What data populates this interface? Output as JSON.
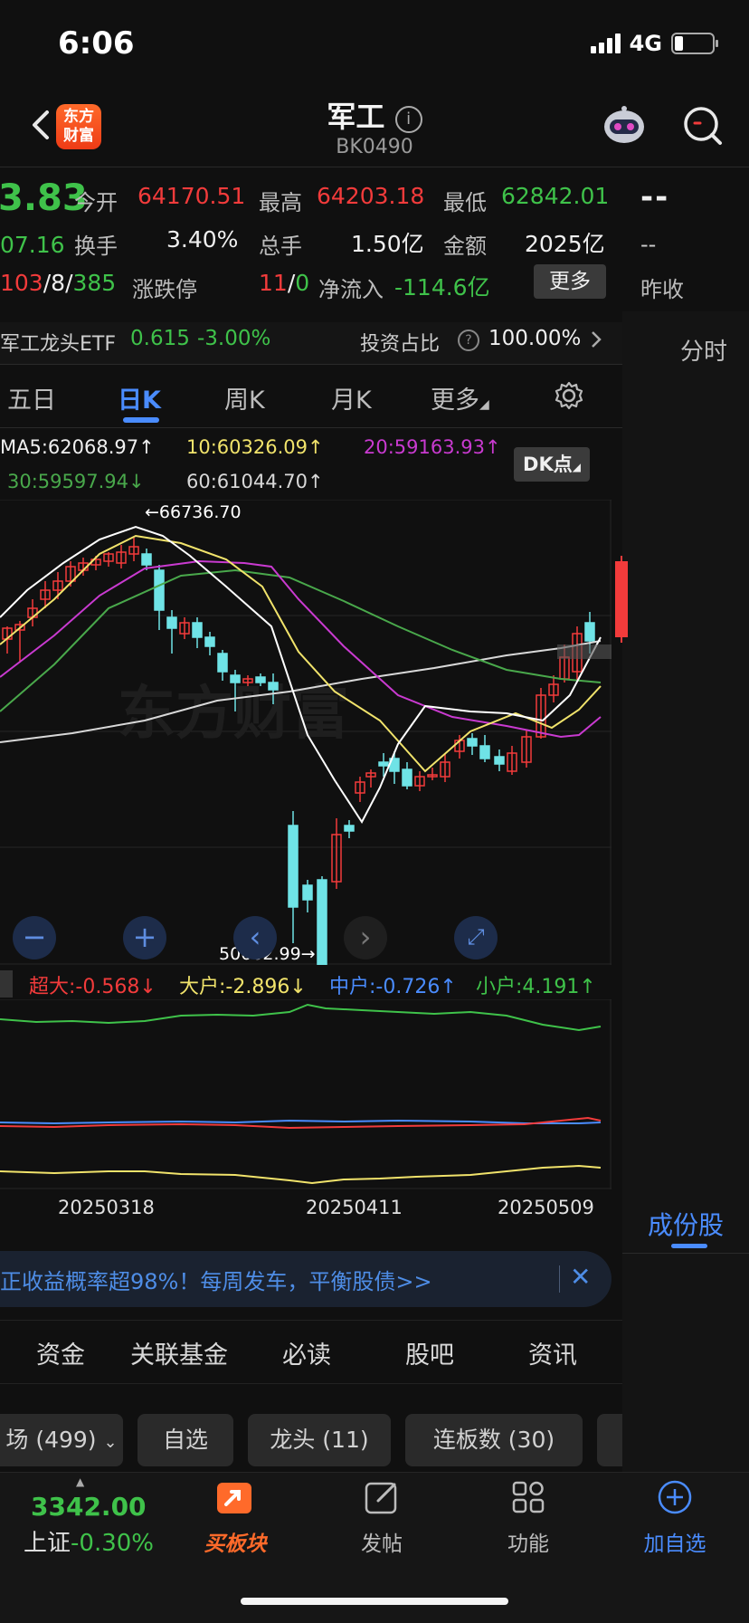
{
  "status": {
    "time": "6:06",
    "network": "4G"
  },
  "header": {
    "title": "军工",
    "code": "BK0490",
    "logo_text": "东方财富"
  },
  "quote": {
    "price_partial": "3.83",
    "change_partial": "07.16",
    "breadth": {
      "up": "103",
      "flat": "8",
      "down": "385"
    },
    "open_label": "今开",
    "open": "64170.51",
    "high_label": "最高",
    "high": "64203.18",
    "low_label": "最低",
    "low": "62842.01",
    "turnover_label": "换手",
    "turnover": "3.40%",
    "volume_label": "总手",
    "volume": "1.50亿",
    "amount_label": "金额",
    "amount": "2025亿",
    "limit_label": "涨跌停",
    "limit_up": "11",
    "limit_down": "0",
    "netflow_label": "净流入",
    "netflow": "-114.6亿",
    "more_label": "更多"
  },
  "right_panel": {
    "dash1": "--",
    "dash2": "--",
    "prev_close_label": "昨收",
    "time_label": "分时",
    "components_label": "成份股"
  },
  "etf": {
    "name": "军工龙头ETF",
    "price": "0.615",
    "change": "-3.00%",
    "ratio_label": "投资占比",
    "ratio": "100.00%"
  },
  "tabs": [
    "五日",
    "日K",
    "周K",
    "月K",
    "更多"
  ],
  "ma": {
    "ma5": "MA5:62068.97",
    "ma10": "10:60326.09",
    "ma20": "20:59163.93",
    "ma30": "30:59597.94",
    "ma60": "60:61044.70",
    "dk": "DK点"
  },
  "chart_marks": {
    "high": "66736.70",
    "low": "50662.99",
    "watermark": "东方财富"
  },
  "flow": {
    "super": "超大:-0.568",
    "large": "大户:-2.896",
    "mid": "中户:-0.726",
    "small": "小户:4.191"
  },
  "dates": [
    "20250318",
    "20250411",
    "20250509"
  ],
  "banner": {
    "text": "正收益概率超98%！每周发车，平衡股债>>"
  },
  "bottom_tabs": [
    "资金",
    "关联基金",
    "必读",
    "股吧",
    "资讯"
  ],
  "chips": [
    "场 (499)",
    "自选",
    "龙头 (11)",
    "连板数 (30)"
  ],
  "index": {
    "value": "3342.00",
    "name": "上证",
    "change": "-0.30%"
  },
  "bottom_nav": [
    "买板块",
    "发帖",
    "功能",
    "加自选"
  ],
  "colors": {
    "up": "#f23b3b",
    "down": "#3fc24a",
    "accent": "#4a8cff",
    "cyan": "#6fe3e6",
    "ma5": "#ffffff",
    "ma10": "#f1e36b",
    "ma20": "#c93ad0",
    "ma30": "#49a84b",
    "ma60": "#d8d8d8"
  }
}
